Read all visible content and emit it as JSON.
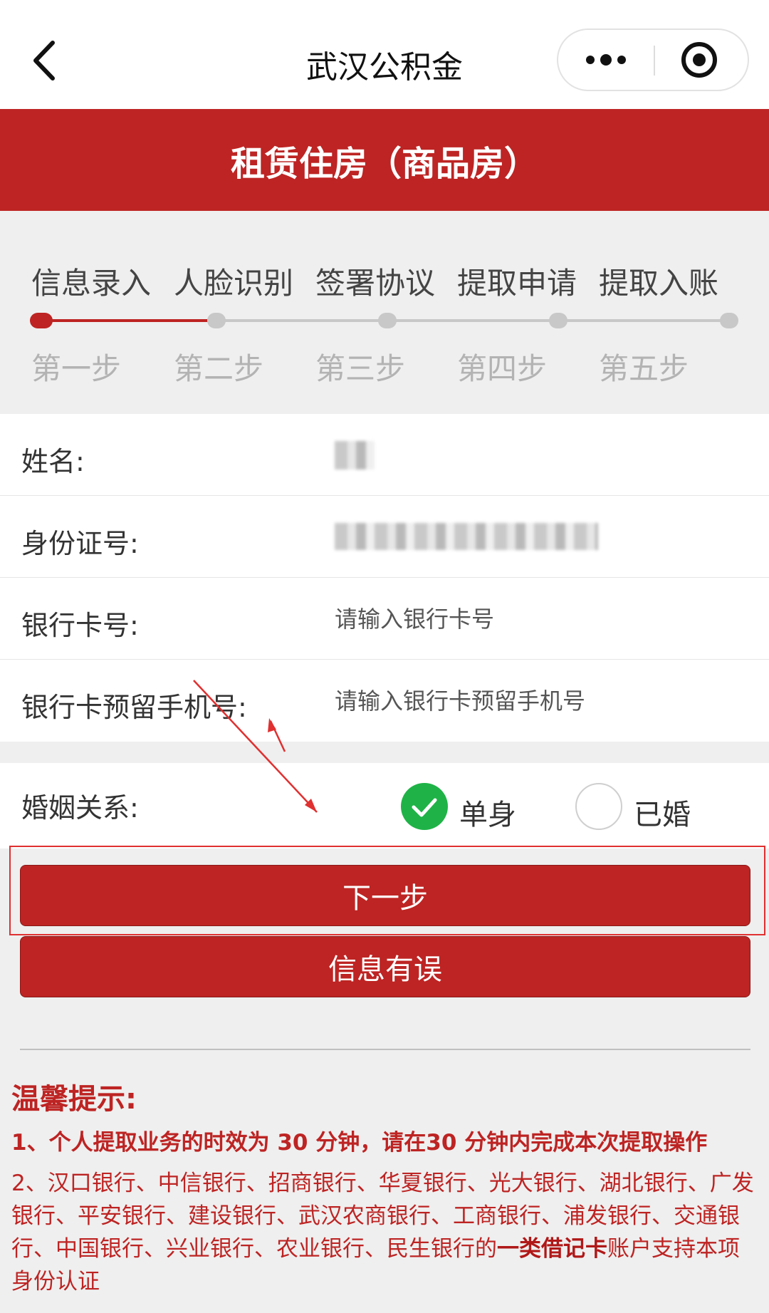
{
  "navbar": {
    "title": "武汉公积金",
    "back_icon": "chevron-left-icon",
    "more_icon": "more-dots-icon",
    "close_icon": "target-close-icon"
  },
  "header": {
    "title": "租赁住房（商品房）"
  },
  "steps": {
    "items": [
      {
        "name": "信息录入",
        "num": "第一步"
      },
      {
        "name": "人脸识别",
        "num": "第二步"
      },
      {
        "name": "签署协议",
        "num": "第三步"
      },
      {
        "name": "提取申请",
        "num": "第四步"
      },
      {
        "name": "提取入账",
        "num": "第五步"
      }
    ],
    "active_index": 0,
    "active_color": "#bd2423"
  },
  "form": {
    "name_label": "姓名:",
    "id_label": "身份证号:",
    "bank_card_label": "银行卡号:",
    "bank_card_placeholder": "请输入银行卡号",
    "phone_label": "银行卡预留手机号:",
    "phone_placeholder": "请输入银行卡预留手机号"
  },
  "marriage": {
    "label": "婚姻关系:",
    "options": [
      "单身",
      "已婚"
    ],
    "selected": "单身"
  },
  "buttons": {
    "next_label": "下一步",
    "error_label": "信息有误"
  },
  "tips": {
    "title": "温馨提示:",
    "tip1": "1、个人提取业务的时效为 30 分钟，请在30 分钟内完成本次提取操作",
    "tip2_prefix": "2、汉口银行、中信银行、招商银行、华夏银行、光大银行、湖北银行、广发银行、平安银行、建设银行、武汉农商银行、工商银行、浦发银行、交通银行、中国银行、兴业银行、农业银行、民生银行的",
    "tip2_bold": "一类借记卡",
    "tip2_suffix": "账户支持本项身份认证"
  },
  "colors": {
    "brand_red": "#bd2423",
    "checked_green": "#1fb347",
    "background": "#efefef"
  }
}
